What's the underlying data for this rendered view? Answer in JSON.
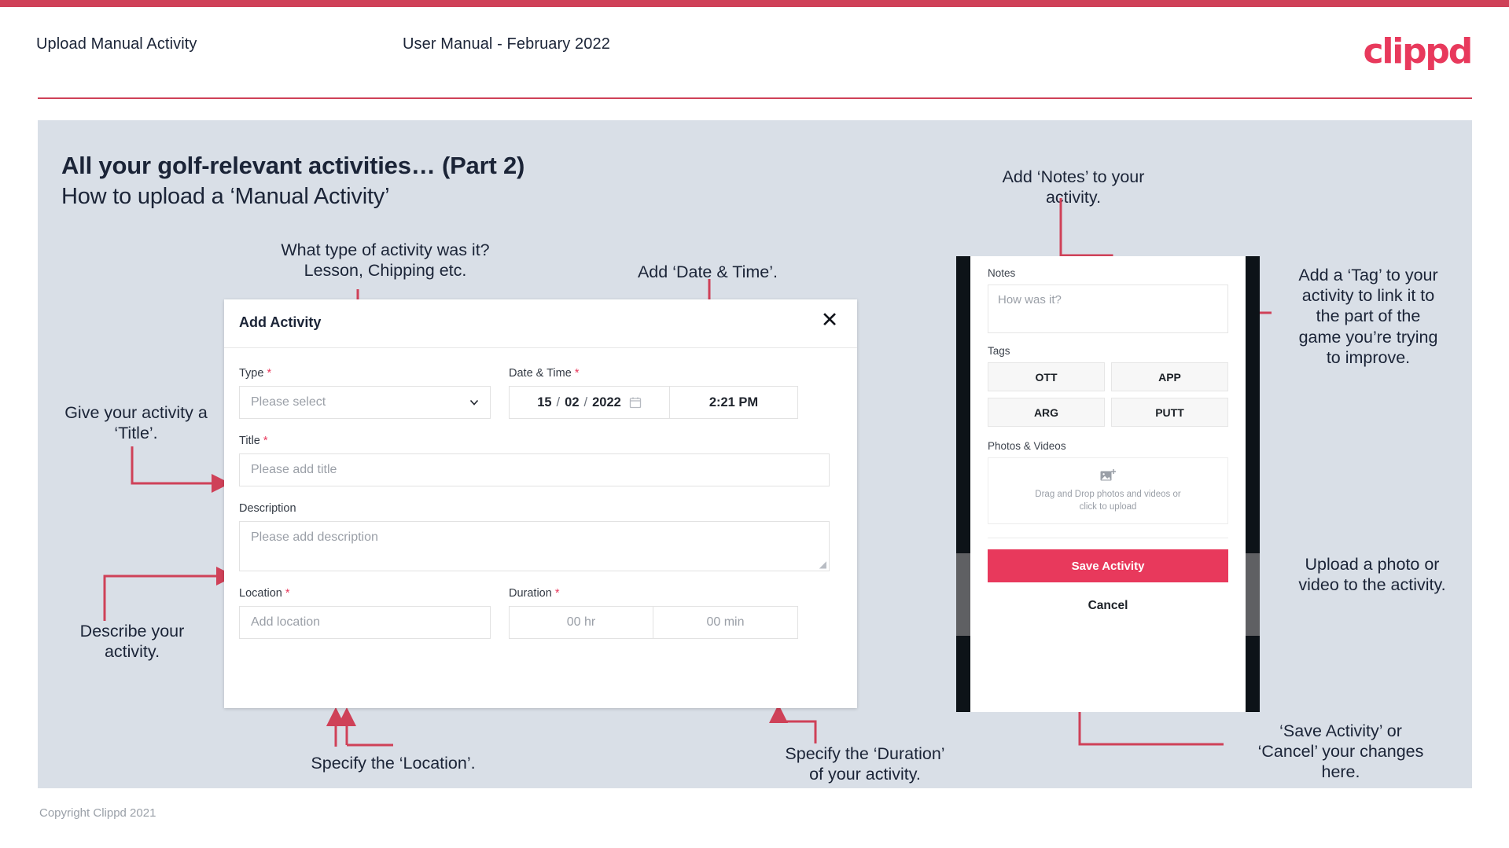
{
  "header": {
    "title": "Upload Manual Activity",
    "subtitle": "User Manual - February 2022",
    "brand": "clippd"
  },
  "slide": {
    "title": "All your golf-relevant activities… (Part 2)",
    "subtitle": "How to upload a ‘Manual Activity’"
  },
  "annotations": {
    "type": "What type of activity was it?\nLesson, Chipping etc.",
    "datetime": "Add ‘Date & Time’.",
    "title": "Give your activity a\n‘Title’.",
    "description": "Describe your\nactivity.",
    "location": "Specify the ‘Location’.",
    "duration": "Specify the ‘Duration’\nof your activity.",
    "notes": "Add ‘Notes’ to your\nactivity.",
    "tags": "Add a ‘Tag’ to your\nactivity to link it to\nthe part of the\ngame you’re trying\nto improve.",
    "photos": "Upload a photo or\nvideo to the activity.",
    "save": "‘Save Activity’ or\n‘Cancel’ your changes\nhere."
  },
  "modal": {
    "title": "Add Activity",
    "close_icon": "close-icon",
    "fields": {
      "type": {
        "label": "Type",
        "required": "*",
        "placeholder": "Please select",
        "chevron_icon": "chevron-down-icon"
      },
      "datetime": {
        "label": "Date & Time",
        "required": "*",
        "day": "15",
        "sep1": "/",
        "month": "02",
        "sep2": "/",
        "year": "2022",
        "calendar_icon": "calendar-icon",
        "time": "2:21 PM"
      },
      "title": {
        "label": "Title",
        "required": "*",
        "placeholder": "Please add title"
      },
      "description": {
        "label": "Description",
        "required": "",
        "placeholder": "Please add description"
      },
      "location": {
        "label": "Location",
        "required": "*",
        "placeholder": "Add location"
      },
      "duration": {
        "label": "Duration",
        "required": "*",
        "hours_placeholder": "00 hr",
        "minutes_placeholder": "00 min"
      }
    }
  },
  "phone": {
    "notes": {
      "label": "Notes",
      "placeholder": "How was it?"
    },
    "tags": {
      "label": "Tags",
      "items": [
        "OTT",
        "APP",
        "ARG",
        "PUTT"
      ]
    },
    "photos": {
      "label": "Photos & Videos",
      "icon": "add-image-icon",
      "dropzone_line1": "Drag and Drop photos and videos or",
      "dropzone_line2": "click to upload"
    },
    "save_label": "Save Activity",
    "cancel_label": "Cancel"
  },
  "footer": {
    "copyright": "Copyright Clippd 2021"
  },
  "colors": {
    "accent": "#e8395c",
    "accent_dark": "#cf4158",
    "slide_bg": "#d9dfe7",
    "text": "#1b2437"
  }
}
